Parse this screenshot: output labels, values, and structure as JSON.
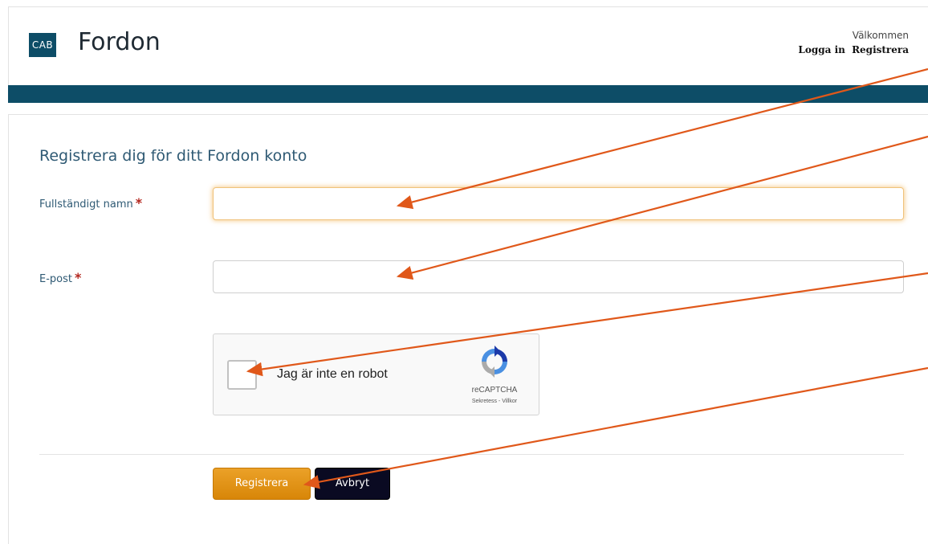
{
  "header": {
    "logo_text": "CAB",
    "app_title": "Fordon",
    "welcome": "Välkommen",
    "login_link": "Logga in",
    "register_link": "Registrera"
  },
  "form": {
    "heading": "Registrera dig för ditt Fordon konto",
    "fullname_label": "Fullständigt namn",
    "fullname_value": "",
    "email_label": "E-post",
    "email_value": "",
    "required_mark": "*",
    "captcha": {
      "label": "Jag är inte en robot",
      "brand": "reCAPTCHA",
      "terms": "Sekretess - Villkor",
      "checked": false
    },
    "submit_label": "Registrera",
    "cancel_label": "Avbryt"
  },
  "colors": {
    "brand_bar": "#0d4d67",
    "primary_button": "#e4930d",
    "cancel_button": "#0a0a22",
    "annotation_arrow": "#e0581a"
  },
  "annotations": {
    "arrow_color": "#e0581a",
    "count": 4
  }
}
